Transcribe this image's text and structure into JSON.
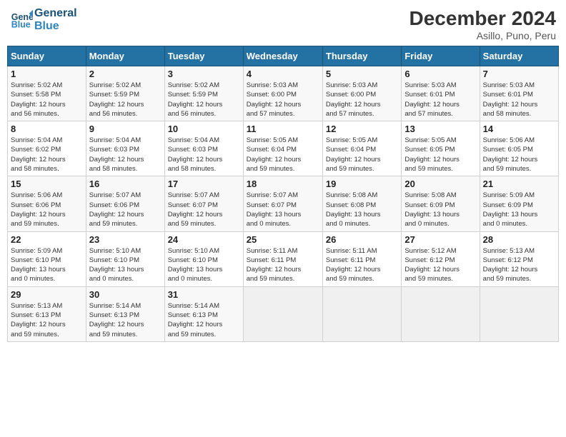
{
  "header": {
    "logo_line1": "General",
    "logo_line2": "Blue",
    "month_year": "December 2024",
    "location": "Asillo, Puno, Peru"
  },
  "weekdays": [
    "Sunday",
    "Monday",
    "Tuesday",
    "Wednesday",
    "Thursday",
    "Friday",
    "Saturday"
  ],
  "weeks": [
    [
      {
        "day": "1",
        "info": "Sunrise: 5:02 AM\nSunset: 5:58 PM\nDaylight: 12 hours\nand 56 minutes."
      },
      {
        "day": "2",
        "info": "Sunrise: 5:02 AM\nSunset: 5:59 PM\nDaylight: 12 hours\nand 56 minutes."
      },
      {
        "day": "3",
        "info": "Sunrise: 5:02 AM\nSunset: 5:59 PM\nDaylight: 12 hours\nand 56 minutes."
      },
      {
        "day": "4",
        "info": "Sunrise: 5:03 AM\nSunset: 6:00 PM\nDaylight: 12 hours\nand 57 minutes."
      },
      {
        "day": "5",
        "info": "Sunrise: 5:03 AM\nSunset: 6:00 PM\nDaylight: 12 hours\nand 57 minutes."
      },
      {
        "day": "6",
        "info": "Sunrise: 5:03 AM\nSunset: 6:01 PM\nDaylight: 12 hours\nand 57 minutes."
      },
      {
        "day": "7",
        "info": "Sunrise: 5:03 AM\nSunset: 6:01 PM\nDaylight: 12 hours\nand 58 minutes."
      }
    ],
    [
      {
        "day": "8",
        "info": "Sunrise: 5:04 AM\nSunset: 6:02 PM\nDaylight: 12 hours\nand 58 minutes."
      },
      {
        "day": "9",
        "info": "Sunrise: 5:04 AM\nSunset: 6:03 PM\nDaylight: 12 hours\nand 58 minutes."
      },
      {
        "day": "10",
        "info": "Sunrise: 5:04 AM\nSunset: 6:03 PM\nDaylight: 12 hours\nand 58 minutes."
      },
      {
        "day": "11",
        "info": "Sunrise: 5:05 AM\nSunset: 6:04 PM\nDaylight: 12 hours\nand 59 minutes."
      },
      {
        "day": "12",
        "info": "Sunrise: 5:05 AM\nSunset: 6:04 PM\nDaylight: 12 hours\nand 59 minutes."
      },
      {
        "day": "13",
        "info": "Sunrise: 5:05 AM\nSunset: 6:05 PM\nDaylight: 12 hours\nand 59 minutes."
      },
      {
        "day": "14",
        "info": "Sunrise: 5:06 AM\nSunset: 6:05 PM\nDaylight: 12 hours\nand 59 minutes."
      }
    ],
    [
      {
        "day": "15",
        "info": "Sunrise: 5:06 AM\nSunset: 6:06 PM\nDaylight: 12 hours\nand 59 minutes."
      },
      {
        "day": "16",
        "info": "Sunrise: 5:07 AM\nSunset: 6:06 PM\nDaylight: 12 hours\nand 59 minutes."
      },
      {
        "day": "17",
        "info": "Sunrise: 5:07 AM\nSunset: 6:07 PM\nDaylight: 12 hours\nand 59 minutes."
      },
      {
        "day": "18",
        "info": "Sunrise: 5:07 AM\nSunset: 6:07 PM\nDaylight: 13 hours\nand 0 minutes."
      },
      {
        "day": "19",
        "info": "Sunrise: 5:08 AM\nSunset: 6:08 PM\nDaylight: 13 hours\nand 0 minutes."
      },
      {
        "day": "20",
        "info": "Sunrise: 5:08 AM\nSunset: 6:09 PM\nDaylight: 13 hours\nand 0 minutes."
      },
      {
        "day": "21",
        "info": "Sunrise: 5:09 AM\nSunset: 6:09 PM\nDaylight: 13 hours\nand 0 minutes."
      }
    ],
    [
      {
        "day": "22",
        "info": "Sunrise: 5:09 AM\nSunset: 6:10 PM\nDaylight: 13 hours\nand 0 minutes."
      },
      {
        "day": "23",
        "info": "Sunrise: 5:10 AM\nSunset: 6:10 PM\nDaylight: 13 hours\nand 0 minutes."
      },
      {
        "day": "24",
        "info": "Sunrise: 5:10 AM\nSunset: 6:10 PM\nDaylight: 13 hours\nand 0 minutes."
      },
      {
        "day": "25",
        "info": "Sunrise: 5:11 AM\nSunset: 6:11 PM\nDaylight: 12 hours\nand 59 minutes."
      },
      {
        "day": "26",
        "info": "Sunrise: 5:11 AM\nSunset: 6:11 PM\nDaylight: 12 hours\nand 59 minutes."
      },
      {
        "day": "27",
        "info": "Sunrise: 5:12 AM\nSunset: 6:12 PM\nDaylight: 12 hours\nand 59 minutes."
      },
      {
        "day": "28",
        "info": "Sunrise: 5:13 AM\nSunset: 6:12 PM\nDaylight: 12 hours\nand 59 minutes."
      }
    ],
    [
      {
        "day": "29",
        "info": "Sunrise: 5:13 AM\nSunset: 6:13 PM\nDaylight: 12 hours\nand 59 minutes."
      },
      {
        "day": "30",
        "info": "Sunrise: 5:14 AM\nSunset: 6:13 PM\nDaylight: 12 hours\nand 59 minutes."
      },
      {
        "day": "31",
        "info": "Sunrise: 5:14 AM\nSunset: 6:13 PM\nDaylight: 12 hours\nand 59 minutes."
      },
      null,
      null,
      null,
      null
    ]
  ]
}
